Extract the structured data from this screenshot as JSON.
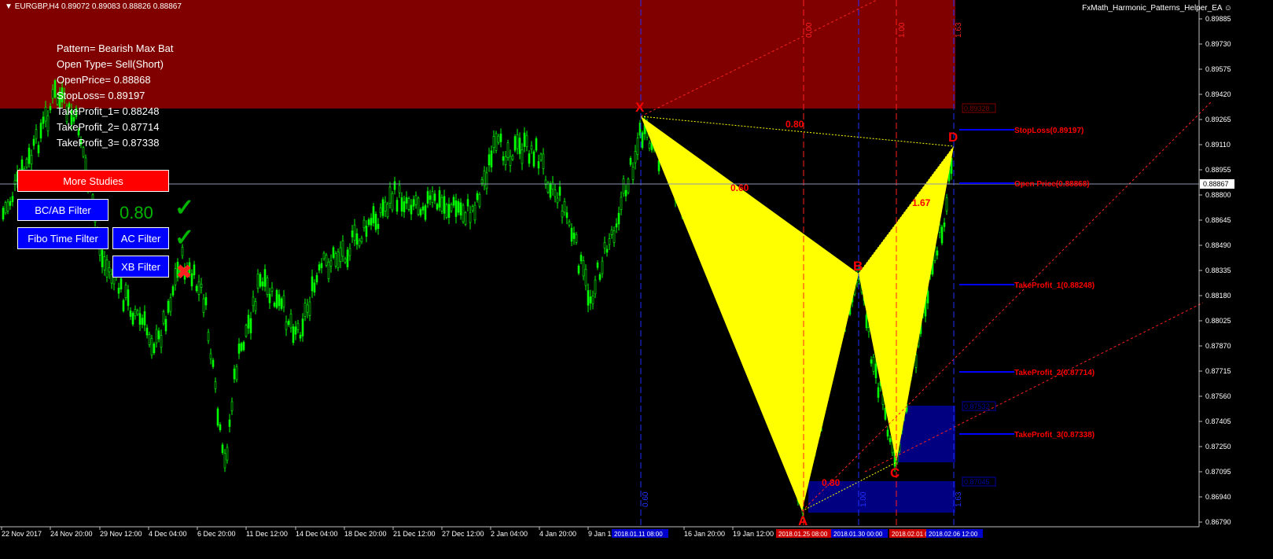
{
  "window": {
    "symbol_title": "EURGBP,H4  0.89072 0.89083 0.88826 0.88867",
    "ea_name": "FxMath_Harmonic_Patterns_Helper_EA"
  },
  "info_panel": {
    "pattern": "Pattern= Bearish Max Bat",
    "open_type": "Open Type= Sell(Short)",
    "open_price": "OpenPrice= 0.88868",
    "stop_loss": "StopLoss= 0.89197",
    "tp1": "TakeProfit_1= 0.88248",
    "tp2": "TakeProfit_2= 0.87714",
    "tp3": "TakeProfit_3= 0.87338"
  },
  "buttons": {
    "more_studies": "More Studies",
    "bc_ab_filter": "BC/AB Filter",
    "fibo_time_filter": "Fibo Time Filter",
    "ac_filter": "AC Filter",
    "xb_filter": "XB Filter"
  },
  "filter_ratio": "0.80",
  "filter_status": {
    "bc_ab": "pass",
    "ac": "pass",
    "xb": "fail"
  },
  "price_axis": {
    "labels": [
      "0.89885",
      "0.89730",
      "0.89575",
      "0.89420",
      "0.89265",
      "0.89110",
      "0.88955",
      "0.88800",
      "0.88645",
      "0.88490",
      "0.88335",
      "0.88180",
      "0.88025",
      "0.87870",
      "0.87715",
      "0.87560",
      "0.87405",
      "0.87250",
      "0.87095",
      "0.86940",
      "0.86790"
    ],
    "current": "0.88867"
  },
  "time_axis": {
    "labels": [
      "22 Nov 2017",
      "24 Nov 20:00",
      "29 Nov 12:00",
      "4 Dec 04:00",
      "6 Dec 20:00",
      "11 Dec 12:00",
      "14 Dec 04:00",
      "18 Dec 20:00",
      "21 Dec 12:00",
      "27 Dec 12:00",
      "2 Jan 04:00",
      "4 Jan 20:00",
      "9 Jan 12:00",
      "16 Jan 20:00",
      "19 Jan 12:00"
    ],
    "markers": [
      {
        "text": "2018.01.11 08:00",
        "color": "#0000cc"
      },
      {
        "text": "2018.01.25 08:00",
        "color": "#cc0000"
      },
      {
        "text": "2018.01.30 00:00",
        "color": "#0000cc"
      },
      {
        "text": "2018.02.01 08:00",
        "color": "#cc0000"
      },
      {
        "text": "2018.02.06 12:00",
        "color": "#0000cc"
      }
    ]
  },
  "pattern_points": {
    "x": "X",
    "a": "A",
    "b": "B",
    "c": "C",
    "d": "D"
  },
  "pattern_ratios": {
    "xd": "0.80",
    "xa_ab": "0.60",
    "bc_cd": "1.67",
    "ac": "0.80"
  },
  "vertical_ratios": {
    "v1": "0.00",
    "v2": "1.00",
    "v3": "1.63",
    "v4": "0.60",
    "v5": "1.00",
    "v6": "1.63"
  },
  "levels": {
    "stop_loss": "StopLoss(0.89197)",
    "open_price": "Open Price(0.88868)",
    "tp1": "TakeProfit_1(0.88248)",
    "tp2": "TakeProfit_2(0.87714)",
    "tp3": "TakeProfit_3(0.87338)",
    "box_top": "0.89328",
    "box_mid1": "0.87532",
    "box_mid2": "0.87045"
  },
  "colors": {
    "background": "#000000",
    "candle": "#00ff00",
    "pattern_fill": "#ffff00",
    "stop_zone": "#800000",
    "target_zone": "#000080",
    "level_text": "#ff0000"
  }
}
